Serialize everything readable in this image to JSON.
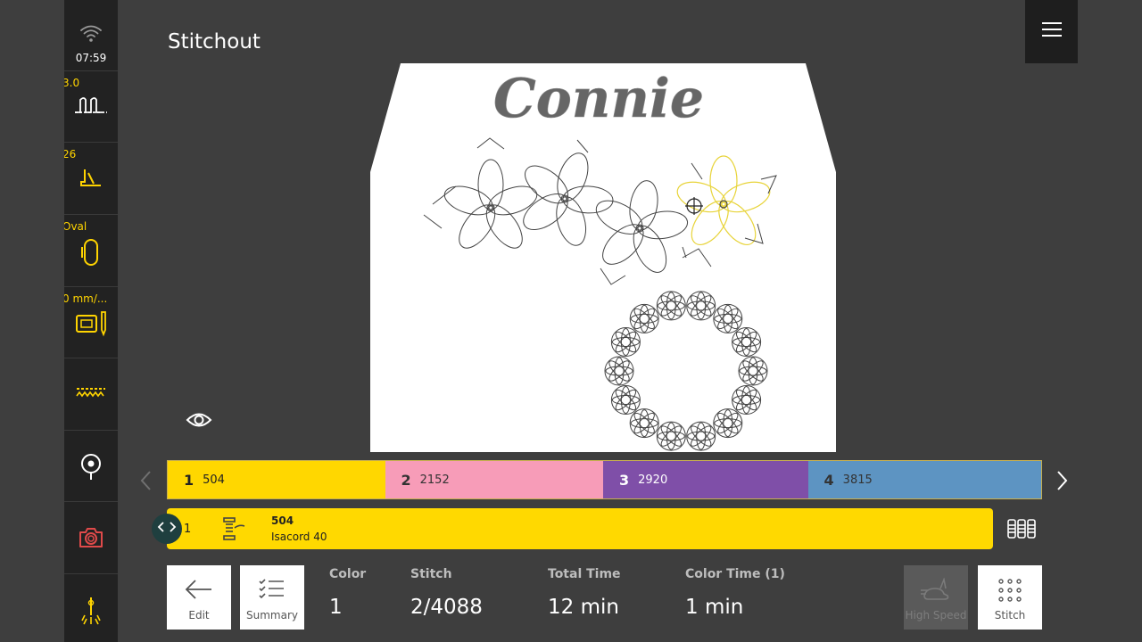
{
  "sidebar": {
    "time": "07:59",
    "items": [
      {
        "label": "",
        "icon": "wifi-icon"
      },
      {
        "label": "3.0",
        "icon": "thread-tension-icon"
      },
      {
        "label": "26",
        "icon": "presser-foot-icon"
      },
      {
        "label": "Oval",
        "icon": "hoop-oval-icon"
      },
      {
        "label": "0 mm/...",
        "icon": "needle-position-icon"
      },
      {
        "label": "",
        "icon": "feed-dogs-icon"
      },
      {
        "label": "",
        "icon": "location-pin-icon"
      },
      {
        "label": "",
        "icon": "camera-icon"
      },
      {
        "label": "",
        "icon": "needle-light-icon"
      }
    ]
  },
  "header": {
    "title": "Stitchout"
  },
  "design": {
    "text": "Connie"
  },
  "colors": {
    "accent": "#ffd900",
    "segments": [
      {
        "num": "1",
        "code": "504",
        "color": "#ffd700",
        "text_color": "#222222"
      },
      {
        "num": "2",
        "code": "2152",
        "color": "#f79cb8",
        "text_color": "#333333"
      },
      {
        "num": "3",
        "code": "2920",
        "color": "#7f4fa8",
        "text_color": "#ffffff"
      },
      {
        "num": "4",
        "code": "3815",
        "color": "#5d94c2",
        "text_color": "#333333"
      }
    ]
  },
  "thread": {
    "num": "1",
    "code": "504",
    "brand": "Isacord 40"
  },
  "buttons": {
    "edit": "Edit",
    "summary": "Summary",
    "high_speed": "High Speed",
    "stitch": "Stitch"
  },
  "info": {
    "color_label": "Color",
    "color_value": "1",
    "stitch_label": "Stitch",
    "stitch_value": "2/4088",
    "total_time_label": "Total Time",
    "total_time_value": "12 min",
    "color_time_label": "Color Time (1)",
    "color_time_value": "1 min"
  }
}
